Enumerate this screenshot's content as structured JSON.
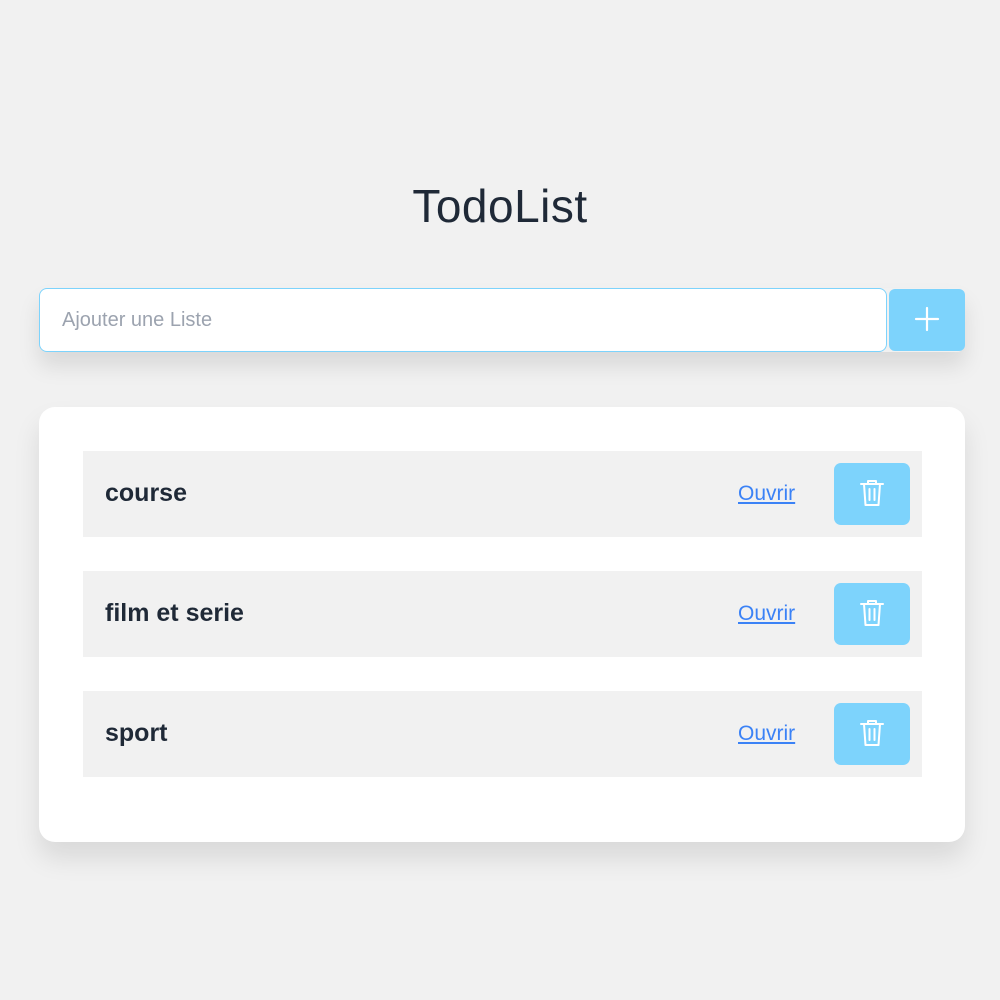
{
  "header": {
    "title": "TodoList"
  },
  "add_form": {
    "placeholder": "Ajouter une Liste",
    "value": "",
    "add_icon": "plus-icon"
  },
  "lists": [
    {
      "name": "course",
      "open_label": "Ouvrir",
      "delete_icon": "trash-icon"
    },
    {
      "name": "film et serie",
      "open_label": "Ouvrir",
      "delete_icon": "trash-icon"
    },
    {
      "name": "sport",
      "open_label": "Ouvrir",
      "delete_icon": "trash-icon"
    }
  ],
  "colors": {
    "background": "#f1f1f1",
    "accent": "#7dd3fc",
    "link": "#3b82f6",
    "text": "#1f2937",
    "card": "#ffffff"
  }
}
